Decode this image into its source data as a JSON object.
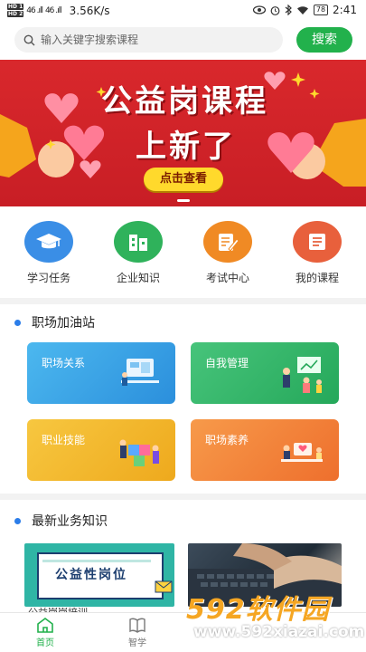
{
  "status_bar": {
    "sim1": "HD 1",
    "sim2": "HD 2",
    "signal1": "46 .ıll",
    "signal2": "46 .ıll",
    "speed": "3.56K/s",
    "battery": "78",
    "time": "2:41"
  },
  "search": {
    "placeholder": "输入关键字搜索课程",
    "button_label": "搜索"
  },
  "banner": {
    "title_line1": "公益岗课程",
    "title_line2": "上新了",
    "cta": "点击查看"
  },
  "quick_nav": [
    {
      "label": "学习任务",
      "icon": "graduation-cap-icon",
      "color": "#3a8ee6"
    },
    {
      "label": "企业知识",
      "icon": "building-icon",
      "color": "#2fb25b"
    },
    {
      "label": "考试中心",
      "icon": "exam-pen-icon",
      "color": "#f08a24"
    },
    {
      "label": "我的课程",
      "icon": "course-list-icon",
      "color": "#e8603c"
    }
  ],
  "section_workplace": {
    "title": "职场加油站",
    "cards": [
      {
        "label": "职场关系",
        "color": "#3aa6e6"
      },
      {
        "label": "自我管理",
        "color": "#34b86a"
      },
      {
        "label": "职业技能",
        "color": "#f0b62a"
      },
      {
        "label": "职场素养",
        "color": "#f07a3a"
      }
    ]
  },
  "section_news": {
    "title": "最新业务知识",
    "thumb1_title": "公益性岗位",
    "thumb1_caption": "公益岗岗培训"
  },
  "tabbar": {
    "home_label": "首页",
    "study_label": "智学"
  },
  "watermark": {
    "brand": "592软件园",
    "url": "www.592xiazai.com"
  },
  "colors": {
    "accent_green": "#22b14c",
    "banner_red": "#d9282c",
    "section_dot": "#2b7de9"
  }
}
